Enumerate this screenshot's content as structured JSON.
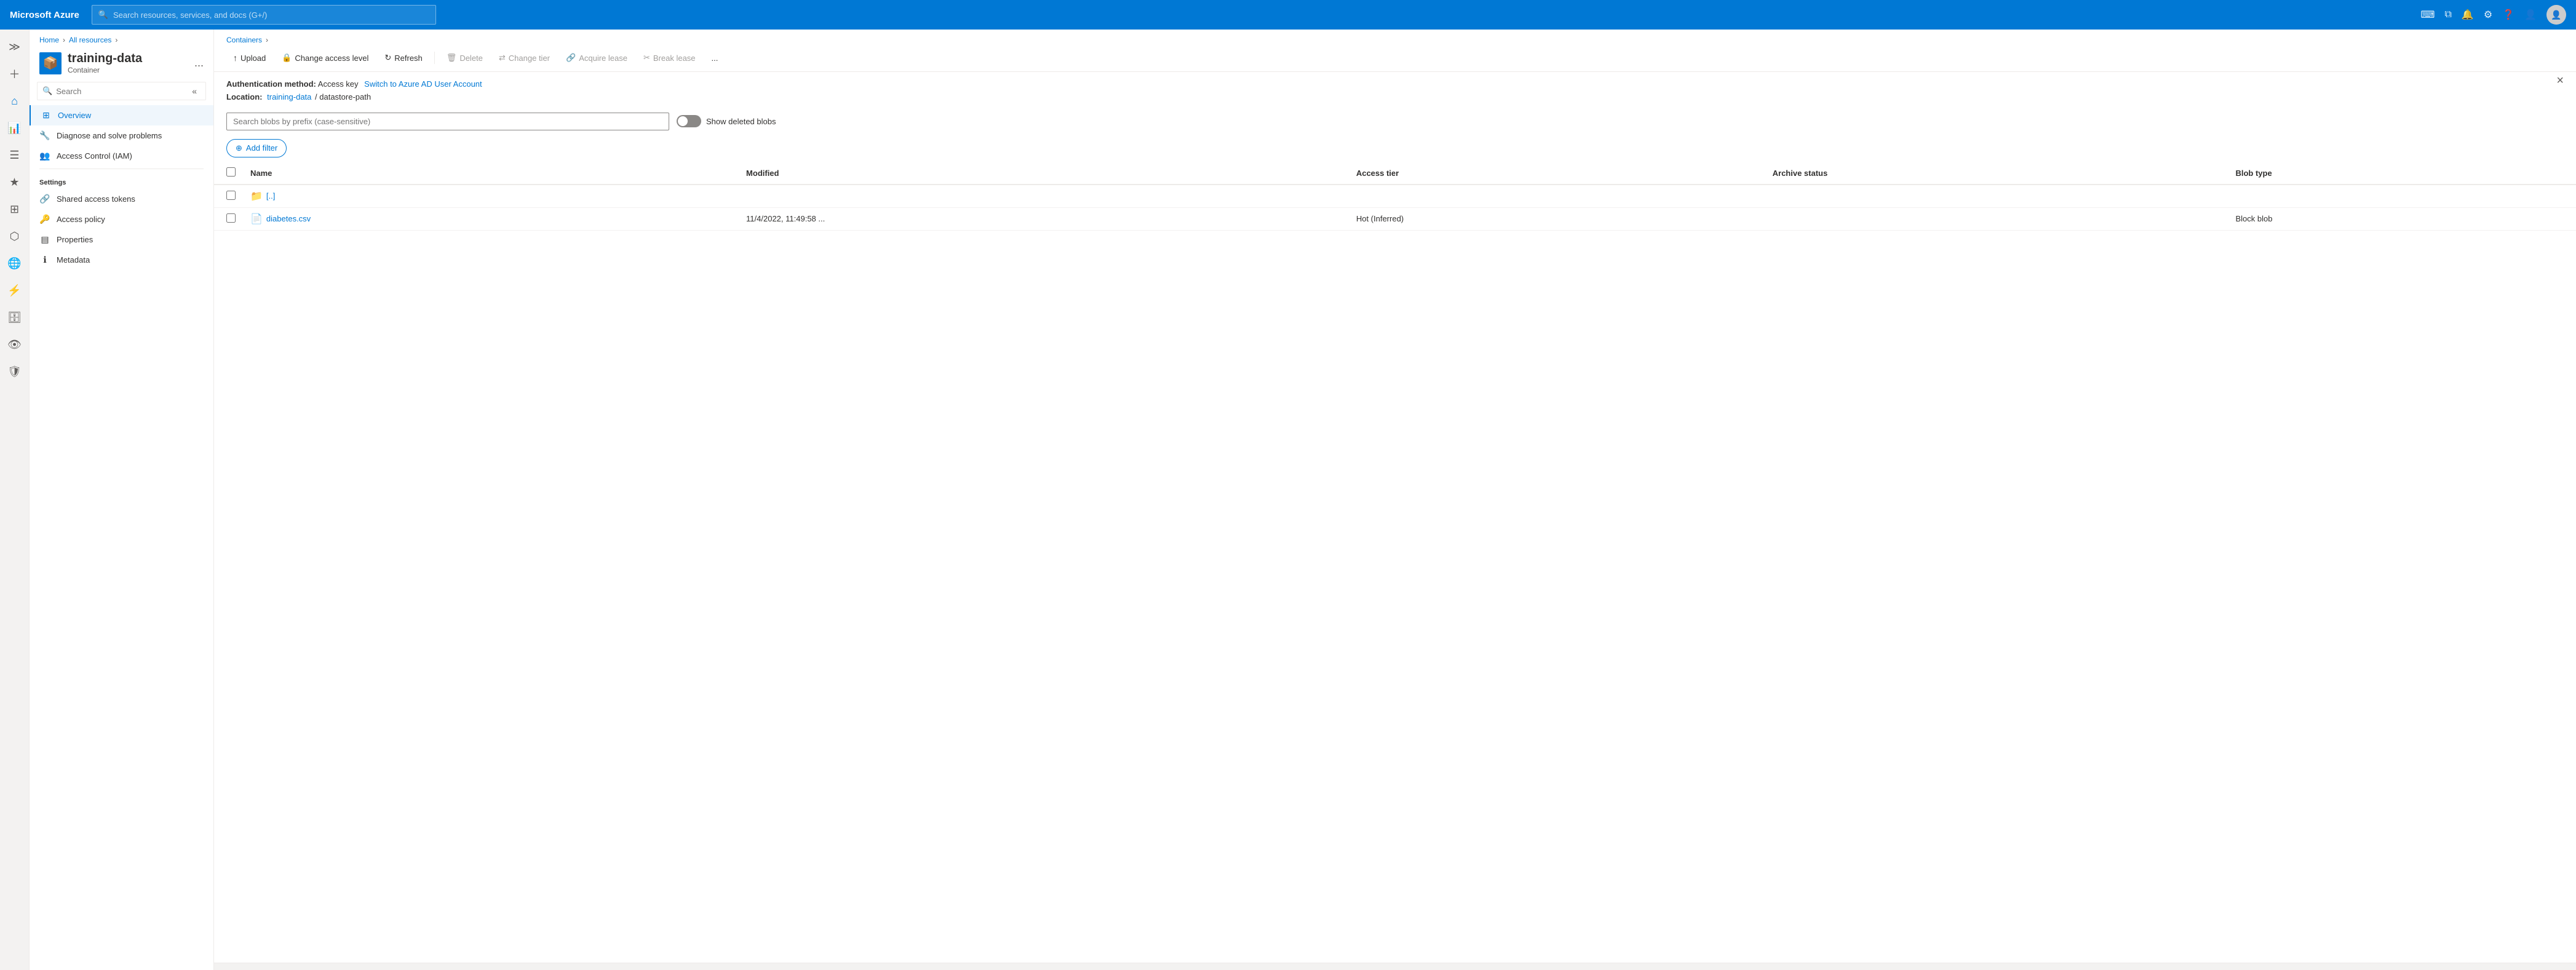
{
  "topbar": {
    "brand": "Microsoft Azure",
    "search_placeholder": "Search resources, services, and docs (G+/)",
    "icons": [
      "terminal-icon",
      "portal-icon",
      "bell-icon",
      "gear-icon",
      "help-icon",
      "person-icon"
    ]
  },
  "breadcrumb": {
    "items": [
      "Home",
      "All resources",
      "Containers"
    ],
    "separators": [
      ">",
      ">",
      ">"
    ]
  },
  "resource": {
    "title": "training-data",
    "subtitle": "Container",
    "more_label": "..."
  },
  "nav_search": {
    "placeholder": "Search",
    "collapse_label": "«"
  },
  "nav_items": [
    {
      "label": "Overview",
      "icon": "grid-icon",
      "active": true
    }
  ],
  "nav_other": [
    {
      "label": "Diagnose and solve problems",
      "icon": "wrench-icon"
    },
    {
      "label": "Access Control (IAM)",
      "icon": "people-icon"
    }
  ],
  "settings_section": {
    "title": "Settings",
    "items": [
      {
        "label": "Shared access tokens",
        "icon": "link-icon"
      },
      {
        "label": "Access policy",
        "icon": "key-icon"
      },
      {
        "label": "Properties",
        "icon": "bars-icon"
      },
      {
        "label": "Metadata",
        "icon": "info-icon"
      }
    ]
  },
  "toolbar": {
    "upload_label": "Upload",
    "change_access_label": "Change access level",
    "refresh_label": "Refresh",
    "delete_label": "Delete",
    "change_tier_label": "Change tier",
    "acquire_lease_label": "Acquire lease",
    "break_lease_label": "Break lease",
    "more_label": "..."
  },
  "auth": {
    "method_label": "Authentication method:",
    "method_value": "Access key",
    "switch_link": "Switch to Azure AD User Account",
    "location_label": "Location:",
    "location_link": "training-data",
    "location_path": "/ datastore-path"
  },
  "blob_search": {
    "placeholder": "Search blobs by prefix (case-sensitive)",
    "show_deleted_label": "Show deleted blobs",
    "toggle_on": false
  },
  "filter": {
    "add_filter_label": "Add filter",
    "icon": "+"
  },
  "table": {
    "columns": [
      "Name",
      "Modified",
      "Access tier",
      "Archive status",
      "Blob type"
    ],
    "rows": [
      {
        "type": "folder",
        "name": "[..]",
        "modified": "",
        "access_tier": "",
        "archive_status": "",
        "blob_type": ""
      },
      {
        "type": "file",
        "name": "diabetes.csv",
        "modified": "11/4/2022, 11:49:58 ...",
        "access_tier": "Hot (Inferred)",
        "archive_status": "",
        "blob_type": "Block blob"
      }
    ]
  },
  "close_button": "×"
}
